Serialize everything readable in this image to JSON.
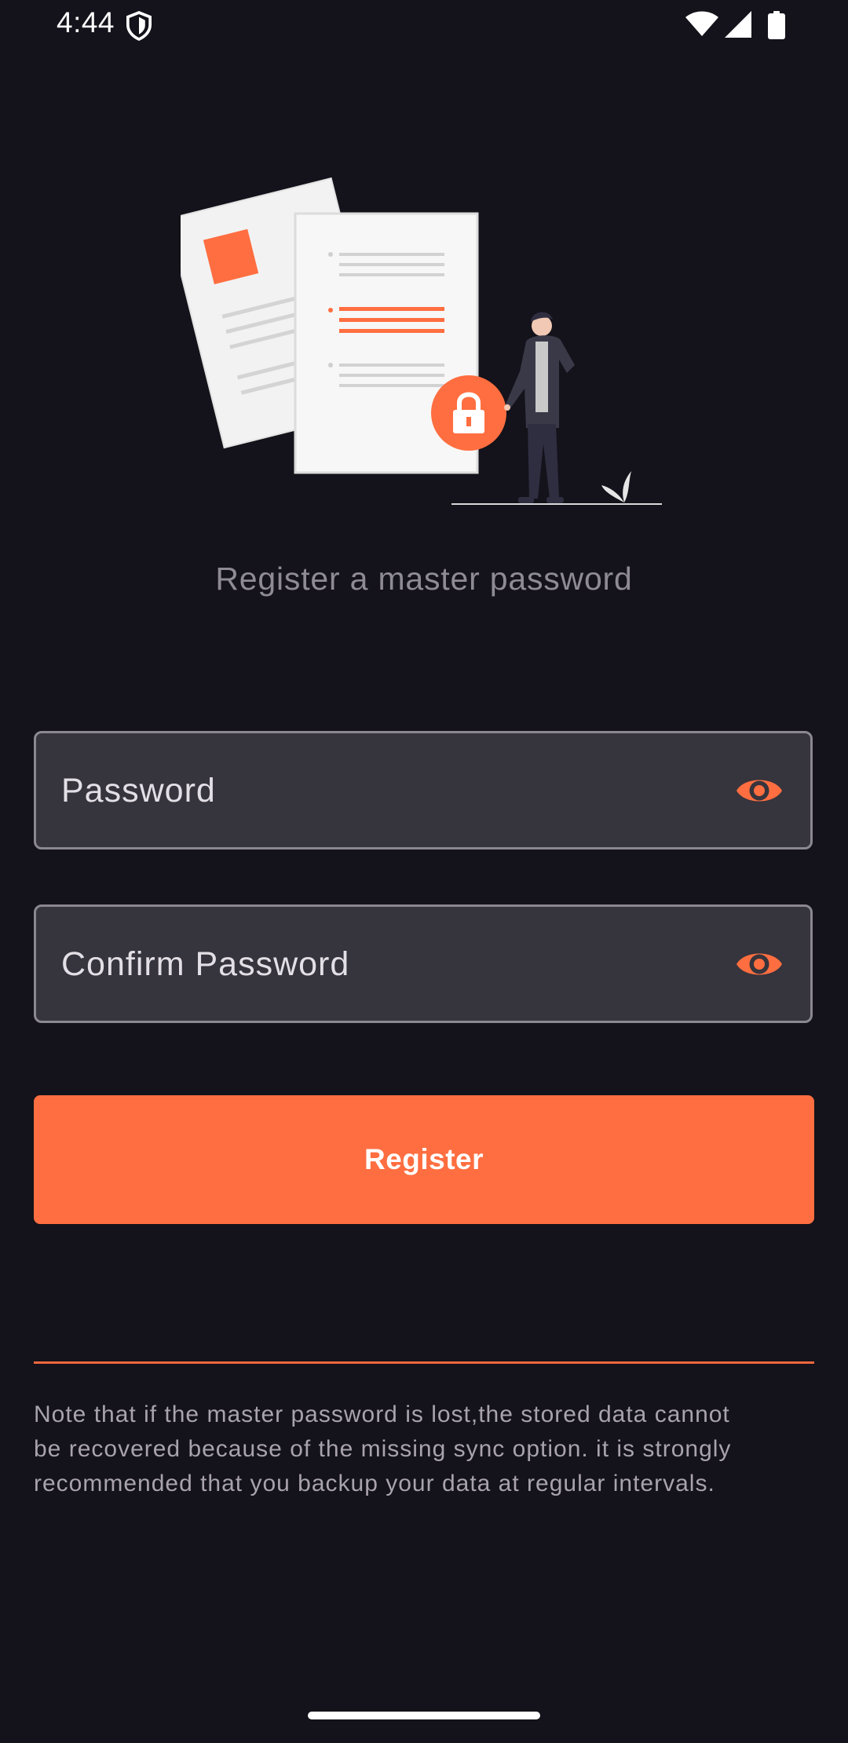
{
  "status_bar": {
    "time": "4:44",
    "icons": [
      "shield-icon",
      "wifi-icon",
      "signal-icon",
      "battery-icon"
    ]
  },
  "illustration": {
    "icon": "secure-documents-illustration",
    "accent_color": "#ff6e40"
  },
  "subtitle": "Register a master password",
  "form": {
    "password": {
      "placeholder": "Password",
      "value": "",
      "visibility_icon": "eye-icon"
    },
    "confirm_password": {
      "placeholder": "Confirm Password",
      "value": "",
      "visibility_icon": "eye-icon"
    },
    "register_label": "Register"
  },
  "note": "Note that if the master password is lost,the stored data cannot\nbe recovered because of the missing sync option. it is strongly\nrecommended that you backup your  data at regular intervals.",
  "colors": {
    "background": "#14121a",
    "accent": "#ff6e40",
    "field_background": "#36343c",
    "field_border": "#8b8891",
    "muted_text": "#8f8b96"
  }
}
